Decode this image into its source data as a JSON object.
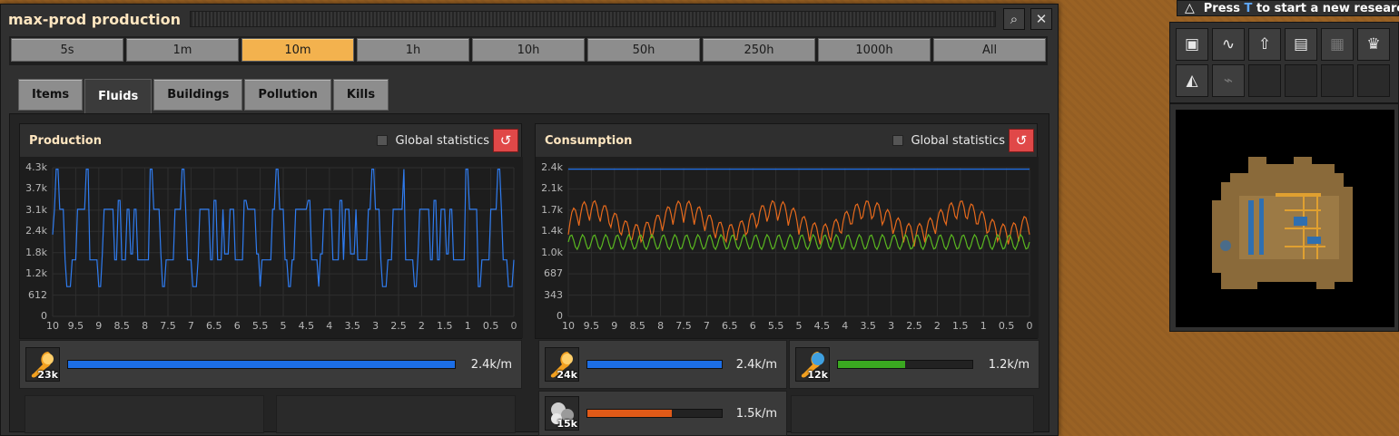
{
  "window": {
    "title": "max-prod production",
    "search_icon": "search-icon",
    "close_icon": "close-icon"
  },
  "time_ranges": [
    {
      "label": "5s",
      "active": false
    },
    {
      "label": "1m",
      "active": false
    },
    {
      "label": "10m",
      "active": true
    },
    {
      "label": "1h",
      "active": false
    },
    {
      "label": "10h",
      "active": false
    },
    {
      "label": "50h",
      "active": false
    },
    {
      "label": "250h",
      "active": false
    },
    {
      "label": "1000h",
      "active": false
    },
    {
      "label": "All",
      "active": false
    }
  ],
  "tabs": [
    {
      "label": "Items",
      "active": false
    },
    {
      "label": "Fluids",
      "active": true
    },
    {
      "label": "Buildings",
      "active": false
    },
    {
      "label": "Pollution",
      "active": false
    },
    {
      "label": "Kills",
      "active": false
    }
  ],
  "production": {
    "title": "Production",
    "global_label": "Global statistics",
    "y_ticks": [
      "4.3k",
      "3.7k",
      "3.1k",
      "2.4k",
      "1.8k",
      "1.2k",
      "612",
      "0"
    ],
    "x_ticks": [
      "10",
      "9.5",
      "9",
      "8.5",
      "8",
      "7.5",
      "7",
      "6.5",
      "6",
      "5.5",
      "5",
      "4.5",
      "4",
      "3.5",
      "3",
      "2.5",
      "2",
      "1.5",
      "1",
      "0.5",
      "0"
    ],
    "items": [
      {
        "icon": "fluid-orange-icon",
        "count": "23k",
        "rate": "2.4k/m",
        "fraction": 1.0,
        "color": "#1c6ee6"
      }
    ]
  },
  "consumption": {
    "title": "Consumption",
    "global_label": "Global statistics",
    "y_ticks": [
      "2.4k",
      "2.1k",
      "1.7k",
      "1.4k",
      "1.0k",
      "687",
      "343",
      "0"
    ],
    "x_ticks": [
      "10",
      "9.5",
      "9",
      "8.5",
      "8",
      "7.5",
      "7",
      "6.5",
      "6",
      "5.5",
      "5",
      "4.5",
      "4",
      "3.5",
      "3",
      "2.5",
      "2",
      "1.5",
      "1",
      "0.5",
      "0"
    ],
    "items": [
      {
        "icon": "fluid-orange-icon",
        "count": "24k",
        "rate": "2.4k/m",
        "fraction": 1.0,
        "color": "#1c6ee6"
      },
      {
        "icon": "fluid-blue-icon",
        "count": "12k",
        "rate": "1.2k/m",
        "fraction": 0.5,
        "color": "#3aa820"
      },
      {
        "icon": "gas-grey-icon",
        "count": "15k",
        "rate": "1.5k/m",
        "fraction": 0.63,
        "color": "#e05a18"
      }
    ]
  },
  "research": {
    "press": "Press",
    "key": "T",
    "rest": "to start a new research."
  }
}
